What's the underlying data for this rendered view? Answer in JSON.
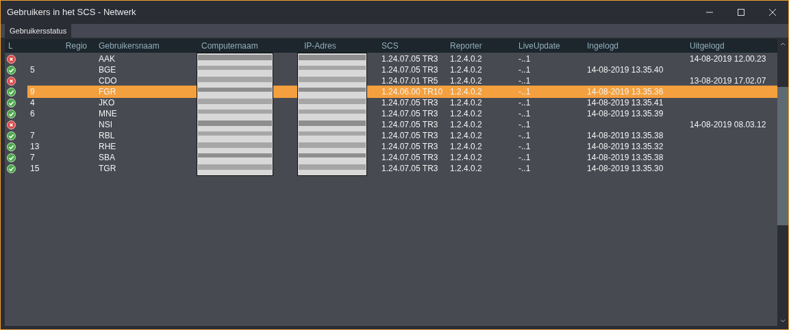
{
  "window": {
    "title": "Gebruikers in het SCS - Netwerk"
  },
  "tabs": [
    {
      "label": "Gebruikersstatus",
      "selected": true
    }
  ],
  "table": {
    "columns": [
      "L",
      "Regio",
      "Gebruikersnaam",
      "Computernaam",
      "IP-Adres",
      "SCS",
      "Reporter",
      "LiveUpdate",
      "Ingelogd",
      "Uitgelogd"
    ],
    "rows": [
      {
        "online": false,
        "selected": false,
        "regio": "",
        "user": "AAK",
        "scs": "1.24.07.05 TR3",
        "reporter": "1.2.4.0.2",
        "liveupdate": "-..1",
        "ingelogd": "",
        "uitgelogd": "14-08-2019 12.00.23"
      },
      {
        "online": true,
        "selected": false,
        "regio": "5",
        "user": "BGE",
        "scs": "1.24.07.05 TR3",
        "reporter": "1.2.4.0.2",
        "liveupdate": "-..1",
        "ingelogd": "14-08-2019 13.35.40",
        "uitgelogd": ""
      },
      {
        "online": false,
        "selected": false,
        "regio": "",
        "user": "CDO",
        "scs": "1.24.07.01 TR5",
        "reporter": "1.2.4.0.2",
        "liveupdate": "-..1",
        "ingelogd": "",
        "uitgelogd": "13-08-2019 17.02.07"
      },
      {
        "online": true,
        "selected": true,
        "regio": "9",
        "user": "FGR",
        "scs": "1.24.06.00 TR10",
        "reporter": "1.2.4.0.2",
        "liveupdate": "-..1",
        "ingelogd": "14-08-2019 13.35.36",
        "uitgelogd": ""
      },
      {
        "online": true,
        "selected": false,
        "regio": "4",
        "user": "JKO",
        "scs": "1.24.07.05 TR3",
        "reporter": "1.2.4.0.2",
        "liveupdate": "-..1",
        "ingelogd": "14-08-2019 13.35.41",
        "uitgelogd": ""
      },
      {
        "online": true,
        "selected": false,
        "regio": "6",
        "user": "MNE",
        "scs": "1.24.07.05 TR3",
        "reporter": "1.2.4.0.2",
        "liveupdate": "-..1",
        "ingelogd": "14-08-2019 13.35.39",
        "uitgelogd": ""
      },
      {
        "online": false,
        "selected": false,
        "regio": "",
        "user": "NSI",
        "scs": "1.24.07.05 TR3",
        "reporter": "1.2.4.0.2",
        "liveupdate": "-..1",
        "ingelogd": "",
        "uitgelogd": "14-08-2019 08.03.12"
      },
      {
        "online": true,
        "selected": false,
        "regio": "7",
        "user": "RBL",
        "scs": "1.24.07.05 TR3",
        "reporter": "1.2.4.0.2",
        "liveupdate": "-..1",
        "ingelogd": "14-08-2019 13.35.38",
        "uitgelogd": ""
      },
      {
        "online": true,
        "selected": false,
        "regio": "13",
        "user": "RHE",
        "scs": "1.24.07.05 TR3",
        "reporter": "1.2.4.0.2",
        "liveupdate": "-..1",
        "ingelogd": "14-08-2019 13.35.32",
        "uitgelogd": ""
      },
      {
        "online": true,
        "selected": false,
        "regio": "7",
        "user": "SBA",
        "scs": "1.24.07.05 TR3",
        "reporter": "1.2.4.0.2",
        "liveupdate": "-..1",
        "ingelogd": "14-08-2019 13.35.38",
        "uitgelogd": ""
      },
      {
        "online": true,
        "selected": false,
        "regio": "15",
        "user": "TGR",
        "scs": "1.24.07.05 TR3",
        "reporter": "1.2.4.0.2",
        "liveupdate": "-..1",
        "ingelogd": "14-08-2019 13.35.30",
        "uitgelogd": ""
      }
    ]
  }
}
